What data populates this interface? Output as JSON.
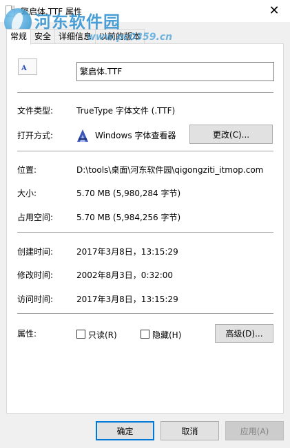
{
  "window": {
    "title": "繁启体.TTF 属性",
    "close_glyph": "✕"
  },
  "watermark": {
    "name": "河东软件园",
    "url": "www.pc0359.cn"
  },
  "tabs": [
    {
      "label": "常规"
    },
    {
      "label": "安全"
    },
    {
      "label": "详细信息"
    },
    {
      "label": "以前的版本"
    }
  ],
  "general": {
    "file_icon_glyph": "A",
    "file_name": "繁启体.TTF",
    "file_type_label": "文件类型:",
    "file_type_value": "TrueType 字体文件 (.TTF)",
    "open_with_label": "打开方式:",
    "open_with_value": "Windows 字体查看器",
    "change_button": "更改(C)...",
    "location_label": "位置:",
    "location_value": "D:\\tools\\桌面\\河东软件园\\qigongziti_itmop.com",
    "size_label": "大小:",
    "size_value": "5.70 MB (5,980,284 字节)",
    "size_on_disk_label": "占用空间:",
    "size_on_disk_value": "5.70 MB (5,984,256 字节)",
    "created_label": "创建时间:",
    "created_value": "2017年3月8日，13:15:29",
    "modified_label": "修改时间:",
    "modified_value": "2002年8月3日，0:32:00",
    "accessed_label": "访问时间:",
    "accessed_value": "2017年3月8日，13:15:29",
    "attributes_label": "属性:",
    "readonly_label": "只读(R)",
    "readonly_checked": false,
    "hidden_label": "隐藏(H)",
    "hidden_checked": false,
    "advanced_button": "高级(D)..."
  },
  "footer": {
    "ok_button": "确定",
    "cancel_button": "取消",
    "apply_button": "应用(A)"
  },
  "colors": {
    "accent": "#0078d7",
    "watermark": "#2a8fd0",
    "dialog_bg": "#f0f0f0",
    "panel_bg": "#ffffff"
  }
}
